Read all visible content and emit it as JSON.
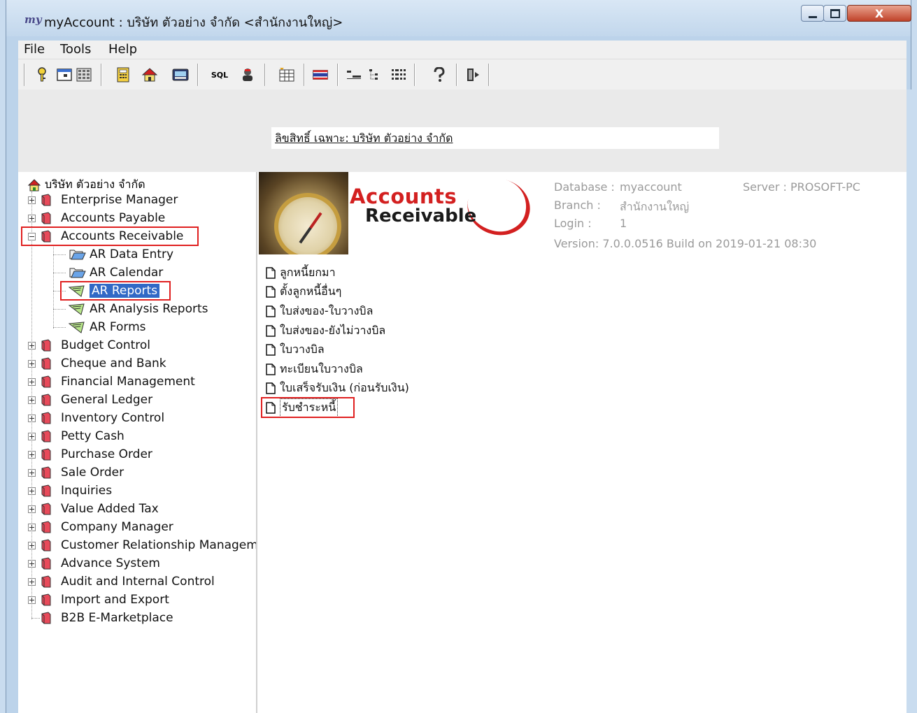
{
  "window": {
    "logo": "my",
    "title": "myAccount : บริษัท ตัวอย่าง จำกัด <สำนักงานใหญ่>",
    "close_glyph": "X"
  },
  "menu": [
    "File",
    "Tools",
    "Help"
  ],
  "toolbar": {
    "sql_label": "SQL",
    "icons": [
      "key-icon",
      "window-icon",
      "grid-icon",
      "calculator-icon",
      "home-icon",
      "screen-icon",
      "sql-icon",
      "user-tool-icon",
      "table-icon",
      "flag-icon",
      "sort-icon",
      "tree-icon",
      "list-icon",
      "help-icon",
      "exit-icon"
    ]
  },
  "license": {
    "text": "ลิขสิทธิ์ เฉพาะ: บริษัท ตัวอย่าง จำกัด"
  },
  "tree": {
    "root": "บริษัท ตัวอย่าง จำกัด",
    "items": [
      "Enterprise Manager",
      "Accounts Payable",
      "Accounts Receivable",
      "AR Data Entry",
      "AR Calendar",
      "AR Reports",
      "AR Analysis Reports",
      "AR Forms",
      "Budget Control",
      "Cheque and Bank",
      "Financial Management",
      "General Ledger",
      "Inventory Control",
      "Petty Cash",
      "Purchase Order",
      "Sale Order",
      "Inquiries",
      "Value Added Tax",
      "Company Manager",
      "Customer Relationship Managemer",
      "Advance System",
      "Audit and Internal Control",
      "Import and Export",
      "B2B E-Marketplace"
    ]
  },
  "hero": {
    "line1": "Accounts",
    "line2": "Receivable"
  },
  "info": {
    "database_label": "Database :",
    "database_value": "myaccount",
    "server": "Server : PROSOFT-PC",
    "branch_label": "Branch :",
    "branch_value": "สำนักงานใหญ่",
    "login_label": "Login :",
    "login_value": "1",
    "version": "Version: 7.0.0.0516  Build on 2019-01-21 08:30"
  },
  "reports": [
    "ลูกหนี้ยกมา",
    "ตั้งลูกหนี้อื่นๆ",
    "ใบส่งของ-ใบวางบิล",
    "ใบส่งของ-ยังไม่วางบิล",
    "ใบวางบิล",
    "ทะเบียนใบวางบิล",
    "ใบเสร็จรับเงิน (ก่อนรับเงิน)",
    "รับชำระหนี้"
  ]
}
